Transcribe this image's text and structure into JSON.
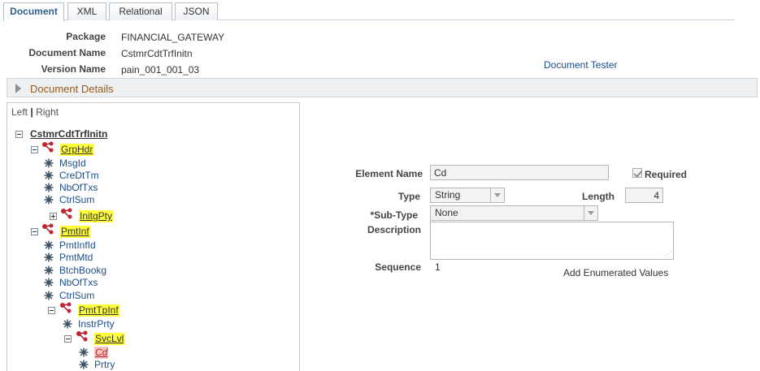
{
  "tabs": [
    {
      "label": "Document",
      "active": true
    },
    {
      "label": "XML",
      "active": false
    },
    {
      "label": "Relational",
      "active": false
    },
    {
      "label": "JSON",
      "active": false
    }
  ],
  "header": {
    "package_label": "Package",
    "package_value": "FINANCIAL_GATEWAY",
    "document_name_label": "Document Name",
    "document_name_value": "CstmrCdtTrfInitn",
    "version_name_label": "Version Name",
    "version_name_value": "pain_001_001_03",
    "document_tester_link": "Document Tester"
  },
  "document_details": {
    "label": "Document Details",
    "collapsed": true
  },
  "tree": {
    "left_label": "Left",
    "separator": "|",
    "right_label": "Right",
    "nodes": [
      {
        "label": "CstmrCdtTrfInitn",
        "kind": "root",
        "toggle": "minus"
      },
      {
        "label": "GrpHdr",
        "kind": "group",
        "toggle": "minus"
      },
      {
        "label": "MsgId",
        "kind": "element"
      },
      {
        "label": "CreDtTm",
        "kind": "element"
      },
      {
        "label": "NbOfTxs",
        "kind": "element"
      },
      {
        "label": "CtrlSum",
        "kind": "element"
      },
      {
        "label": "InitgPty",
        "kind": "group",
        "toggle": "plus"
      },
      {
        "label": "PmtInf",
        "kind": "group",
        "toggle": "minus"
      },
      {
        "label": "PmtInfId",
        "kind": "element"
      },
      {
        "label": "PmtMtd",
        "kind": "element"
      },
      {
        "label": "BtchBookg",
        "kind": "element"
      },
      {
        "label": "NbOfTxs",
        "kind": "element"
      },
      {
        "label": "CtrlSum",
        "kind": "element"
      },
      {
        "label": "PmtTpInf",
        "kind": "group",
        "toggle": "minus"
      },
      {
        "label": "InstrPrty",
        "kind": "element"
      },
      {
        "label": "SvcLvl",
        "kind": "group",
        "toggle": "minus"
      },
      {
        "label": "Cd",
        "kind": "element",
        "selected": true
      },
      {
        "label": "Prtry",
        "kind": "element"
      }
    ]
  },
  "form": {
    "element_name_label": "Element Name",
    "element_name_value": "Cd",
    "required_label": "Required",
    "required_checked": true,
    "type_label": "Type",
    "type_value": "String",
    "length_label": "Length",
    "length_value": "4",
    "subtype_label": "*Sub-Type",
    "subtype_value": "None",
    "description_label": "Description",
    "description_value": "",
    "sequence_label": "Sequence",
    "sequence_value": "1",
    "add_enum_link": "Add Enumerated Values"
  },
  "colors": {
    "link": "#1c4e8a",
    "group_highlight": "#ffff3a",
    "selected_highlight": "#f6c3c3",
    "details_label": "#9a5a1a"
  }
}
